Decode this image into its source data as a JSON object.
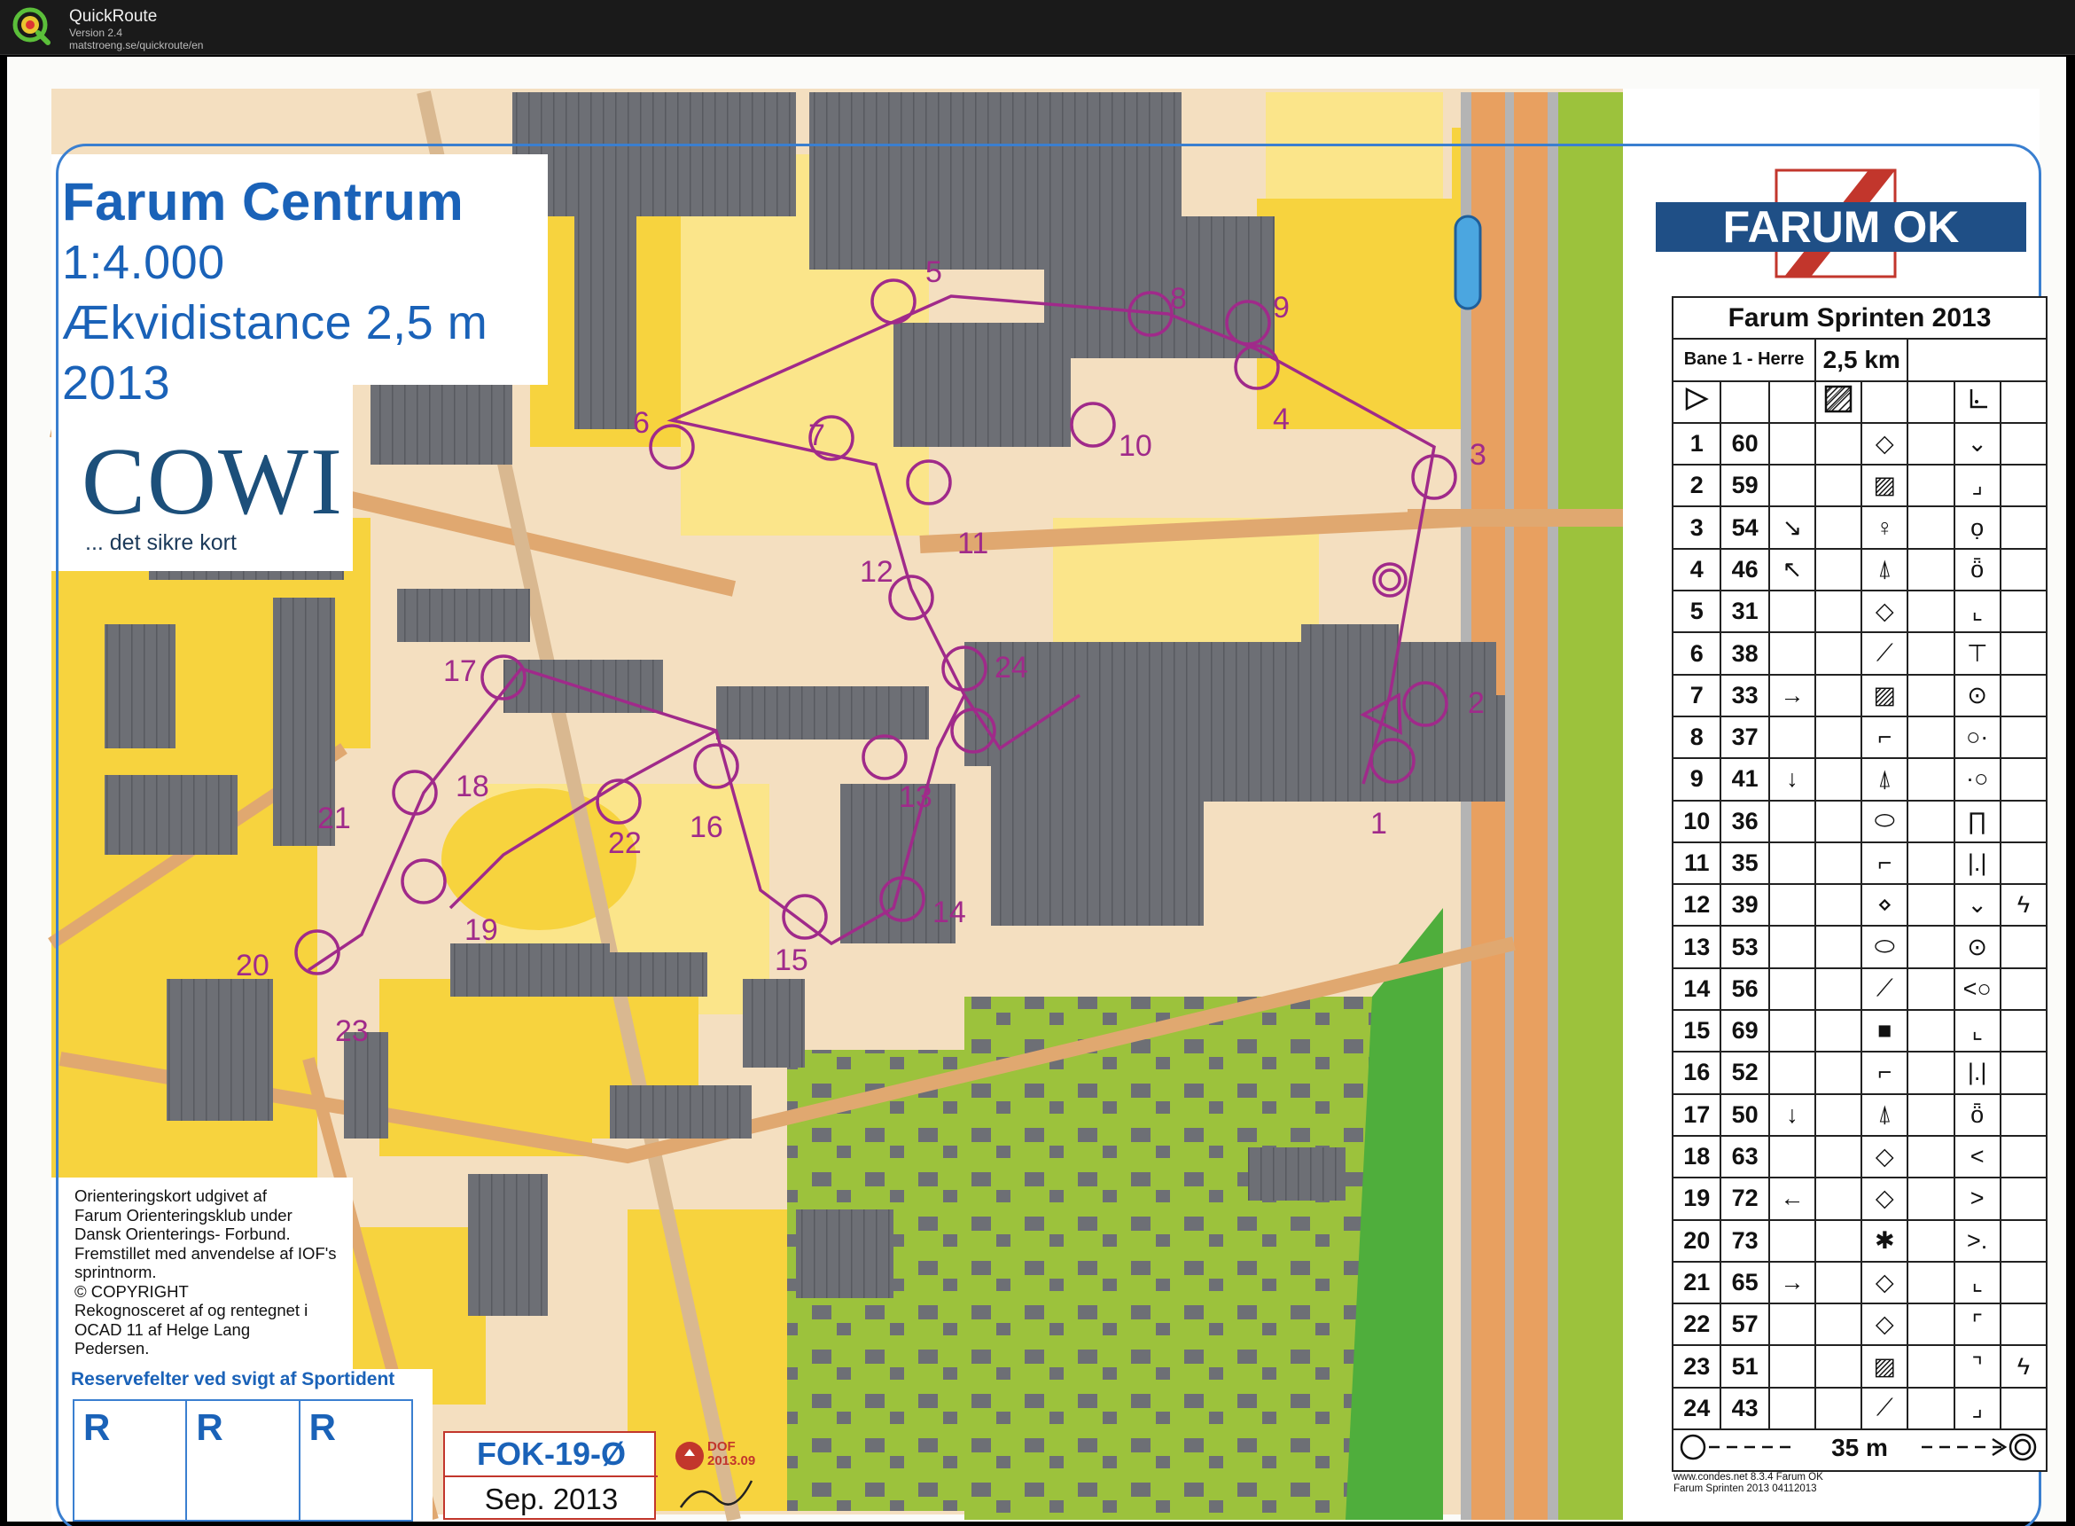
{
  "window": {
    "app_name": "QuickRoute",
    "version": "Version 2.4",
    "url": "matstroeng.se/quickroute/en"
  },
  "map": {
    "title": "Farum Centrum",
    "scale": "1:4.000",
    "equidistance": "Ækvidistance 2,5 m",
    "year": "2013",
    "sponsor": "COWI",
    "sponsor_tagline": "... det sikre kort",
    "copyright_lines": [
      "Orienteringskort udgivet af",
      "Farum Orienteringsklub under",
      "Dansk Orienterings- Forbund.",
      "Fremstillet med anvendelse af IOF's",
      "sprintnorm.",
      "© COPYRIGHT",
      "Rekognosceret af og rentegnet i",
      "OCAD 11 af Helge Lang",
      "Pedersen."
    ],
    "reserve_title": "Reservefelter ved svigt af Sportident",
    "reserve_boxes": [
      "R",
      "R",
      "R"
    ],
    "stamp_code": "FOK-19-Ø",
    "stamp_date": "Sep. 2013",
    "dof_label": "DOF",
    "dof_date": "2013.09",
    "club_logo": "FARUM OK",
    "colors": {
      "paved": "#f4dfc0",
      "open": "#f7d33e",
      "rough_open": "#fbe58a",
      "forest": "#ffffff",
      "green": "#9cc23c",
      "building": "#6d6f75",
      "water": "#4ba6e0",
      "course": "#a02a8a",
      "road": "#e0a870"
    },
    "control_labels": [
      "1",
      "2",
      "3",
      "4",
      "5",
      "6",
      "7",
      "8",
      "9",
      "10",
      "11",
      "12",
      "13",
      "14",
      "15",
      "16",
      "17",
      "18",
      "19",
      "20",
      "21",
      "22",
      "23",
      "24"
    ]
  },
  "control_description": {
    "title": "Farum Sprinten 2013",
    "course": "Bane 1 - Herre",
    "length": "2,5 km",
    "start_symbol": "triangle-start-icon",
    "start_feature": "hatched-square",
    "start_location": "corner-bottom-left",
    "rows": [
      {
        "num": "1",
        "code": "60",
        "dir": "",
        "feature": "◇",
        "loc": "⌄",
        "extra": ""
      },
      {
        "num": "2",
        "code": "59",
        "dir": "",
        "feature": "▨",
        "loc": "⌟",
        "extra": ""
      },
      {
        "num": "3",
        "code": "54",
        "dir": "↘",
        "feature": "♀",
        "loc": "ọ",
        "extra": ""
      },
      {
        "num": "4",
        "code": "46",
        "dir": "↖",
        "feature": "⍋",
        "loc": "ȫ",
        "extra": ""
      },
      {
        "num": "5",
        "code": "31",
        "dir": "",
        "feature": "◇",
        "loc": "⌞",
        "extra": ""
      },
      {
        "num": "6",
        "code": "38",
        "dir": "",
        "feature": "⟋",
        "loc": "⊤",
        "extra": ""
      },
      {
        "num": "7",
        "code": "33",
        "dir": "→",
        "feature": "▨",
        "loc": "⊙",
        "extra": ""
      },
      {
        "num": "8",
        "code": "37",
        "dir": "",
        "feature": "⌐",
        "loc": "○·",
        "extra": ""
      },
      {
        "num": "9",
        "code": "41",
        "dir": "↓",
        "feature": "⍋",
        "loc": "·○",
        "extra": ""
      },
      {
        "num": "10",
        "code": "36",
        "dir": "",
        "feature": "⬭",
        "loc": "∏",
        "extra": ""
      },
      {
        "num": "11",
        "code": "35",
        "dir": "",
        "feature": "⌐",
        "loc": "|.|",
        "extra": ""
      },
      {
        "num": "12",
        "code": "39",
        "dir": "",
        "feature": "⋄",
        "loc": "⌄",
        "extra": "ϟ"
      },
      {
        "num": "13",
        "code": "53",
        "dir": "",
        "feature": "⬭",
        "loc": "⊙",
        "extra": ""
      },
      {
        "num": "14",
        "code": "56",
        "dir": "",
        "feature": "⟋",
        "loc": "<○",
        "extra": ""
      },
      {
        "num": "15",
        "code": "69",
        "dir": "",
        "feature": "■",
        "loc": "⌞",
        "extra": ""
      },
      {
        "num": "16",
        "code": "52",
        "dir": "",
        "feature": "⌐",
        "loc": "|.|",
        "extra": ""
      },
      {
        "num": "17",
        "code": "50",
        "dir": "↓",
        "feature": "⍋",
        "loc": "ȫ",
        "extra": ""
      },
      {
        "num": "18",
        "code": "63",
        "dir": "",
        "feature": "◇",
        "loc": "<",
        "extra": ""
      },
      {
        "num": "19",
        "code": "72",
        "dir": "←",
        "feature": "◇",
        "loc": ">",
        "extra": ""
      },
      {
        "num": "20",
        "code": "73",
        "dir": "",
        "feature": "✱",
        "loc": ">.",
        "extra": ""
      },
      {
        "num": "21",
        "code": "65",
        "dir": "→",
        "feature": "◇",
        "loc": "⌞",
        "extra": ""
      },
      {
        "num": "22",
        "code": "57",
        "dir": "",
        "feature": "◇",
        "loc": "⌜",
        "extra": ""
      },
      {
        "num": "23",
        "code": "51",
        "dir": "",
        "feature": "▨",
        "loc": "⌝",
        "extra": "ϟ"
      },
      {
        "num": "24",
        "code": "43",
        "dir": "",
        "feature": "⟋",
        "loc": "⌟",
        "extra": ""
      }
    ],
    "finish_text": "35 m",
    "credit_lines": [
      "www.condes.net 8.3.4 Farum OK",
      "Farum Sprinten 2013 04112013"
    ]
  }
}
